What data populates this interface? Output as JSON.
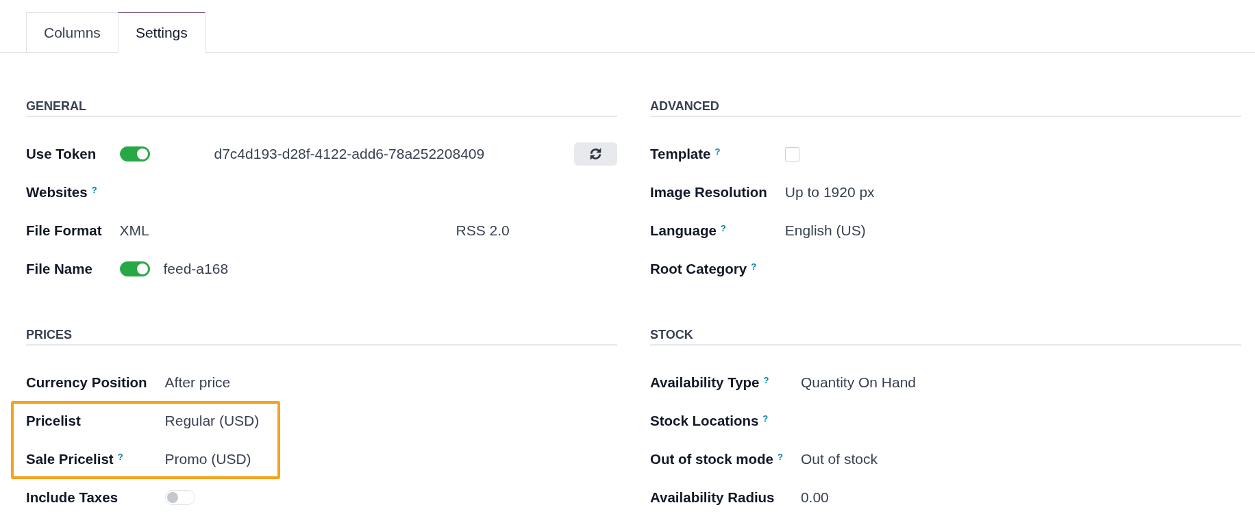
{
  "tabs": [
    {
      "label": "Columns",
      "selected": false
    },
    {
      "label": "Settings",
      "selected": true
    }
  ],
  "sections": [
    {
      "title": "GENERAL",
      "rows": [
        {
          "label": "Use Token",
          "highlighted": false,
          "widgets": [
            {
              "kind": "toggle",
              "on": true
            },
            {
              "kind": "token",
              "value": "d7c4d193-d28f-4122-add6-78a252208409"
            },
            {
              "kind": "icon_button"
            }
          ]
        },
        {
          "label": "Websites",
          "help": "?",
          "highlighted": false
        },
        {
          "label": "File Format",
          "highlighted": false,
          "widgets": [
            {
              "kind": "text",
              "value": "XML"
            },
            {
              "kind": "text",
              "value": "RSS 2.0"
            }
          ]
        },
        {
          "label": "File Name",
          "highlighted": false,
          "widgets": [
            {
              "kind": "toggle",
              "on": true
            },
            {
              "kind": "text",
              "value": "feed-a168"
            }
          ]
        }
      ]
    },
    {
      "title": "ADVANCED",
      "rows": [
        {
          "label": "Template",
          "help": "?",
          "highlighted": false,
          "widgets": [
            {
              "kind": "checkbox",
              "checked": false
            }
          ]
        },
        {
          "label": "Image Resolution",
          "highlighted": false,
          "widgets": [
            {
              "kind": "text",
              "value": "Up to 1920 px"
            }
          ]
        },
        {
          "label": "Language",
          "help": "?",
          "highlighted": false,
          "widgets": [
            {
              "kind": "text",
              "value": "English (US)"
            }
          ]
        },
        {
          "label": "Root Category",
          "help": "?",
          "highlighted": false
        }
      ]
    },
    {
      "title": "PRICES",
      "rows": [
        {
          "label": "Currency Position",
          "highlighted": false,
          "widgets": [
            {
              "kind": "text",
              "value": "After price"
            }
          ]
        },
        {
          "label": "Pricelist",
          "highlighted": true,
          "widgets": [
            {
              "kind": "text",
              "value": "Regular (USD)"
            }
          ]
        },
        {
          "label": "Sale Pricelist",
          "help": "?",
          "highlighted": true,
          "widgets": [
            {
              "kind": "text",
              "value": "Promo (USD)"
            }
          ]
        },
        {
          "label": "Include Taxes",
          "highlighted": false,
          "widgets": [
            {
              "kind": "toggle",
              "on": false
            }
          ]
        }
      ]
    },
    {
      "title": "STOCK",
      "rows": [
        {
          "label": "Availability Type",
          "help": "?",
          "highlighted": false,
          "widgets": [
            {
              "kind": "text",
              "value": "Quantity On Hand"
            }
          ]
        },
        {
          "label": "Stock Locations",
          "help": "?",
          "highlighted": false
        },
        {
          "label": "Out of stock mode",
          "help": "?",
          "highlighted": false,
          "widgets": [
            {
              "kind": "text",
              "value": "Out of stock"
            }
          ]
        },
        {
          "label": "Availability Radius",
          "highlighted": false,
          "widgets": [
            {
              "kind": "text",
              "value": "0.00"
            }
          ]
        }
      ]
    }
  ]
}
